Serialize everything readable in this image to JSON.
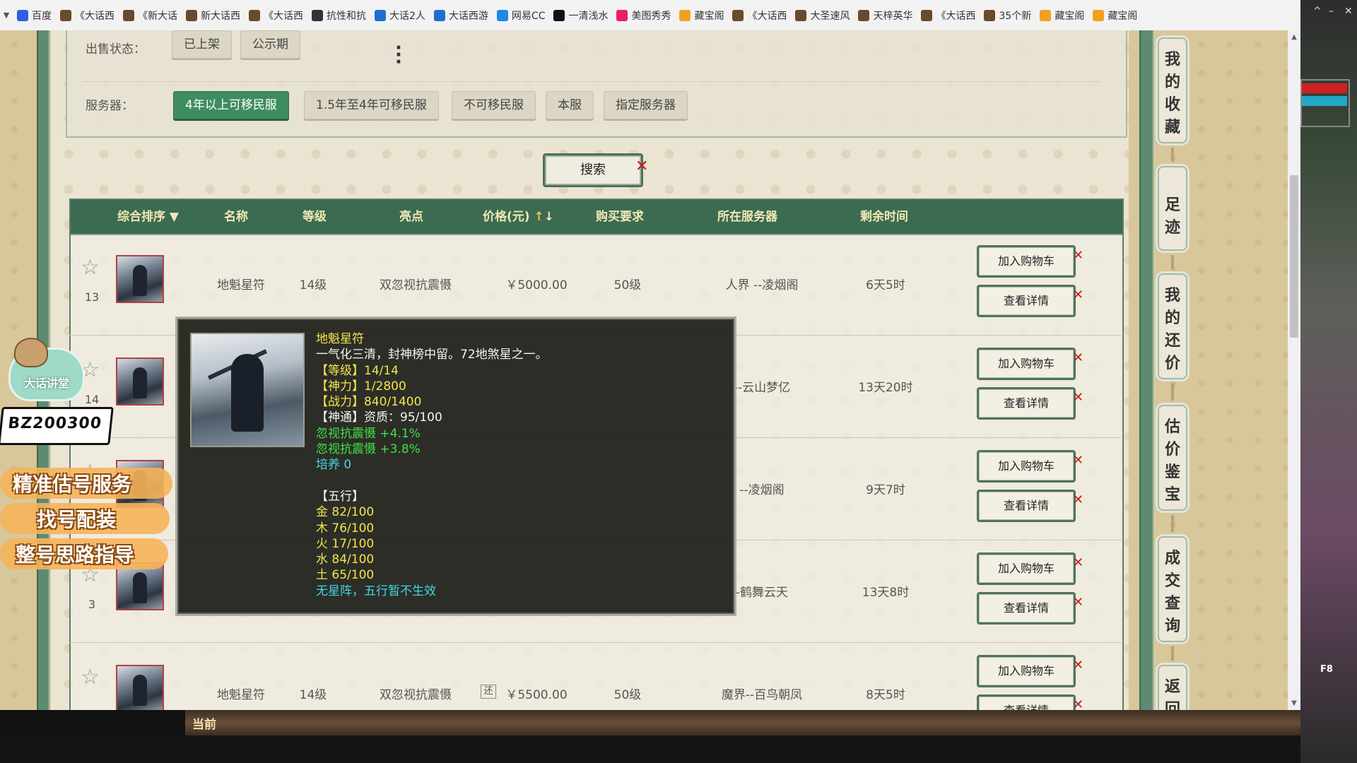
{
  "bookmarks": [
    {
      "label": "百度",
      "color": "#2f5fe0"
    },
    {
      "label": "《大话西",
      "color": "#6b4a2a"
    },
    {
      "label": "《新大话",
      "color": "#6b4a2a"
    },
    {
      "label": "新大话西",
      "color": "#6b4a2a"
    },
    {
      "label": "《大话西",
      "color": "#6b4a2a"
    },
    {
      "label": "抗性和抗",
      "color": "#333333"
    },
    {
      "label": "大话2人",
      "color": "#1f6fd0"
    },
    {
      "label": "大话西游",
      "color": "#1f6fd0"
    },
    {
      "label": "网易CC",
      "color": "#1e88e5"
    },
    {
      "label": "一清浅水",
      "color": "#111111"
    },
    {
      "label": "美图秀秀",
      "color": "#e91e63"
    },
    {
      "label": "藏宝阁",
      "color": "#f0a020"
    },
    {
      "label": "《大话西",
      "color": "#6b4a2a"
    },
    {
      "label": "大圣速风",
      "color": "#6b4a2a"
    },
    {
      "label": "天梓英华",
      "color": "#6b4a2a"
    },
    {
      "label": "《大话西",
      "color": "#6b4a2a"
    },
    {
      "label": "35个新",
      "color": "#6b4a2a"
    },
    {
      "label": "藏宝阁",
      "color": "#f0a020"
    },
    {
      "label": "藏宝阁",
      "color": "#f0a020"
    }
  ],
  "bookmarks_more": "»",
  "filters": {
    "sale_status_label": "出售状态：",
    "sale_status_options": [
      "已上架",
      "公示期"
    ],
    "more_icon": "⋮",
    "server_label": "服务器：",
    "server_options": [
      "4年以上可移民服",
      "1.5年至4年可移民服",
      "不可移民服",
      "本服",
      "指定服务器"
    ],
    "server_active": "4年以上可移民服"
  },
  "search_label": "搜索",
  "table": {
    "headers": {
      "sort": "综合排序",
      "name": "名称",
      "level": "等级",
      "highlight": "亮点",
      "price": "价格(元)",
      "requirement": "购买要求",
      "server": "所在服务器",
      "time_left": "剩余时间"
    },
    "rows": [
      {
        "rank": "13",
        "name": "地魁星符",
        "level": "14级",
        "highlight": "双忽视抗震慑",
        "price": "￥5000.00",
        "requirement": "50级",
        "server": "人界 --凌烟阁",
        "time": "6天5时"
      },
      {
        "rank": "14",
        "name": "",
        "level": "",
        "highlight": "",
        "price": "",
        "requirement": "",
        "server": "--云山梦亿",
        "time": "13天20时"
      },
      {
        "rank": "",
        "name": "",
        "level": "",
        "highlight": "",
        "price": "",
        "requirement": "",
        "server": "--凌烟阁",
        "time": "9天7时"
      },
      {
        "rank": "3",
        "name": "",
        "level": "",
        "highlight": "",
        "price": "",
        "requirement": "",
        "server": "-鹤舞云天",
        "time": "13天8时"
      },
      {
        "rank": "",
        "name": "地魁星符",
        "level": "14级",
        "highlight": "双忽视抗震慑",
        "price": "￥5500.00",
        "price_tag": "还",
        "requirement": "50级",
        "server": "魔界--百鸟朝凤",
        "time": "8天5时"
      }
    ],
    "add_cart_label": "加入购物车",
    "detail_label": "查看详情"
  },
  "tooltip": {
    "name": "地魁星符",
    "desc": "一气化三清，封神榜中留。72地煞星之一。",
    "level": "【等级】14/14",
    "shenli": "【神力】1/2800",
    "zhanli": "【战力】840/1400",
    "shentong": "【神通】资质：95/100",
    "attr1": "忽视抗震慑 +4.1%",
    "attr2": "忽视抗震慑 +3.8%",
    "peiyang": "培养 0",
    "wuxing_title": "【五行】",
    "jin": "金 82/100",
    "mu": "木 76/100",
    "huo": "火 17/100",
    "shui": "水 84/100",
    "tu": "土 65/100",
    "note": "无星阵，五行暂不生效"
  },
  "sidebar": {
    "favorites": "我的收藏",
    "footprint": "足迹",
    "my_offers": "我的还价",
    "appraisal": "估价鉴宝",
    "deals": "成交查询",
    "back": "返回"
  },
  "overlay": {
    "badge": "大话讲堂",
    "id": "BZ200300",
    "promo1": "精准估号服务",
    "promo2": "找号配装",
    "promo3": "整号思路指导"
  },
  "game_bar": {
    "label": "当前",
    "f8": "F8"
  },
  "window_controls": {
    "min": "–",
    "max": "^",
    "close": "✕"
  }
}
